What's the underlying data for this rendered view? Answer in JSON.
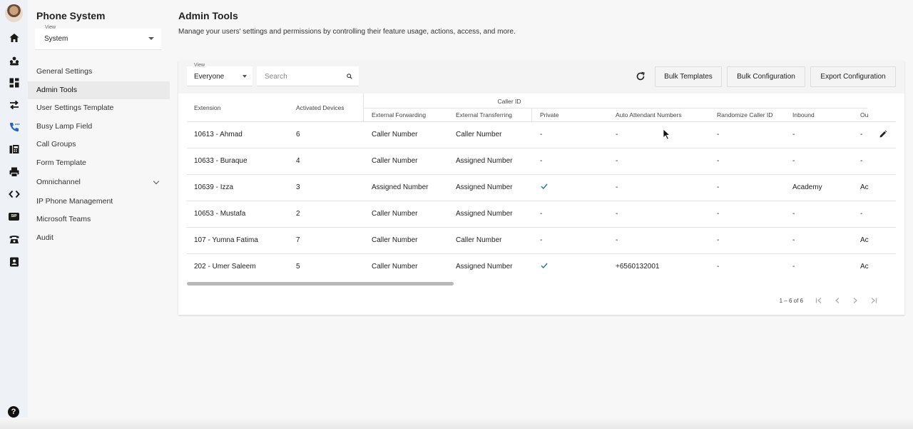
{
  "app": {
    "title": "Phone System"
  },
  "sidebar": {
    "view_label": "View",
    "view_value": "System",
    "items": [
      {
        "label": "General Settings"
      },
      {
        "label": "Admin Tools"
      },
      {
        "label": "User Settings Template"
      },
      {
        "label": "Busy Lamp Field"
      },
      {
        "label": "Call Groups"
      },
      {
        "label": "Form Template"
      },
      {
        "label": "Omnichannel"
      },
      {
        "label": "IP Phone Management"
      },
      {
        "label": "Microsoft Teams"
      },
      {
        "label": "Audit"
      }
    ]
  },
  "rail": {
    "icons": [
      "home-icon",
      "contacts-icon",
      "dashboard-icon",
      "transfer-icon",
      "phone-settings-icon",
      "fax-icon",
      "printer-icon",
      "code-icon",
      "sip-icon",
      "desk-phone-icon",
      "contact-card-icon"
    ],
    "sip_text": "SIP",
    "help_text": "?"
  },
  "main": {
    "title": "Admin Tools",
    "subtitle": "Manage your users' settings and permissions by controlling their feature usage, actions, access, and more."
  },
  "toolbar": {
    "view_label": "View",
    "view_value": "Everyone",
    "search_placeholder": "Search",
    "bulk_templates": "Bulk Templates",
    "bulk_configuration": "Bulk Configuration",
    "export_configuration": "Export Configuration"
  },
  "table": {
    "group_header": "Caller ID",
    "headers": {
      "extension": "Extension",
      "activated_devices": "Activated Devices",
      "external_forwarding": "External Forwarding",
      "external_transferring": "External Transferring",
      "private": "Private",
      "auto_attendant_numbers": "Auto Attendant Numbers",
      "randomize_caller_id": "Randomize Caller ID",
      "inbound": "Inbound",
      "outbound": "Ou"
    },
    "rows": [
      {
        "extension": "10613 - Ahmad",
        "devices": "6",
        "forwarding": "Caller Number",
        "transferring": "Caller Number",
        "private": "-",
        "private_checked": false,
        "auto_attendant": "-",
        "randomize": "-",
        "inbound": "-",
        "outbound": "-"
      },
      {
        "extension": "10633 - Buraque",
        "devices": "4",
        "forwarding": "Caller Number",
        "transferring": "Assigned Number",
        "private": "-",
        "private_checked": false,
        "auto_attendant": "-",
        "randomize": "-",
        "inbound": "-",
        "outbound": "-"
      },
      {
        "extension": "10639 - Izza",
        "devices": "3",
        "forwarding": "Assigned Number",
        "transferring": "Assigned Number",
        "private": "",
        "private_checked": true,
        "auto_attendant": "-",
        "randomize": "-",
        "inbound": "Academy",
        "outbound": "Ac"
      },
      {
        "extension": "10653 - Mustafa",
        "devices": "2",
        "forwarding": "Caller Number",
        "transferring": "Assigned Number",
        "private": "-",
        "private_checked": false,
        "auto_attendant": "-",
        "randomize": "-",
        "inbound": "-",
        "outbound": "-"
      },
      {
        "extension": "107 - Yumna Fatima",
        "devices": "7",
        "forwarding": "Caller Number",
        "transferring": "Caller Number",
        "private": "-",
        "private_checked": false,
        "auto_attendant": "-",
        "randomize": "-",
        "inbound": "-",
        "outbound": "Ac"
      },
      {
        "extension": "202 - Umer Saleem",
        "devices": "5",
        "forwarding": "Caller Number",
        "transferring": "Assigned Number",
        "private": "",
        "private_checked": true,
        "auto_attendant": "+6560132001",
        "randomize": "-",
        "inbound": "-",
        "outbound": "Ac"
      }
    ]
  },
  "pagination": {
    "range": "1 – 6 of 6"
  },
  "colors": {
    "accent": "#1d66c4",
    "check": "#2e6f8e",
    "active_nav_bg": "#eaeaea"
  }
}
